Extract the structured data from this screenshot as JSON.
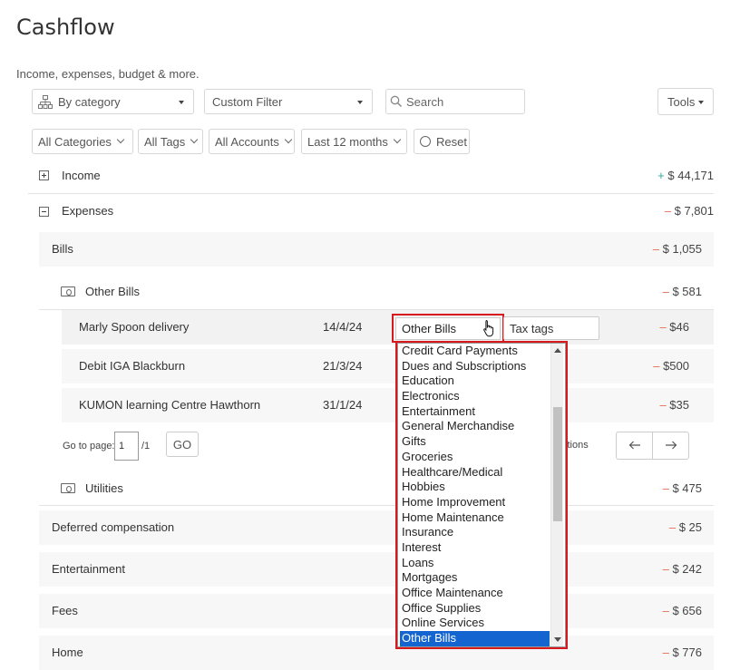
{
  "header": {
    "title": "Cashflow",
    "subtitle": "Income, expenses, budget & more."
  },
  "toolbar": {
    "group_by": "By category",
    "custom_filter": "Custom Filter",
    "search_placeholder": "Search",
    "tools": "Tools"
  },
  "filters": {
    "categories": "All Categories",
    "tags": "All Tags",
    "accounts": "All Accounts",
    "period": "Last 12 months",
    "reset": "Reset"
  },
  "summary": {
    "income": {
      "label": "Income",
      "sign": "+",
      "amount": "$ 44,171"
    },
    "expenses": {
      "label": "Expenses",
      "sign": "–",
      "amount": "$ 7,801"
    }
  },
  "bills": {
    "label": "Bills",
    "sign": "–",
    "amount": "$ 1,055"
  },
  "other_bills": {
    "label": "Other Bills",
    "sign": "–",
    "amount": "$ 581"
  },
  "transactions": [
    {
      "name": "Marly Spoon delivery",
      "date": "14/4/24",
      "sign": "–",
      "amount": "$46"
    },
    {
      "name": "Debit IGA Blackburn",
      "date": "21/3/24",
      "sign": "–",
      "amount": "$500"
    },
    {
      "name": "KUMON learning Centre Hawthorn",
      "date": "31/1/24",
      "sign": "–",
      "amount": "$35"
    }
  ],
  "editor": {
    "category_value": "Other Bills",
    "tags_placeholder": "Tax tags"
  },
  "pagination": {
    "goto_label": "Go to page:",
    "page": "1",
    "total": "/1",
    "go": "GO",
    "transactions_partial": "ctions"
  },
  "utilities": {
    "label": "Utilities",
    "sign": "–",
    "amount": "$ 475"
  },
  "groups": [
    {
      "label": "Deferred compensation",
      "sign": "–",
      "amount": "$ 25"
    },
    {
      "label": "Entertainment",
      "sign": "–",
      "amount": "$ 242"
    },
    {
      "label": "Fees",
      "sign": "–",
      "amount": "$ 656"
    },
    {
      "label": "Home",
      "sign": "–",
      "amount": "$ 776"
    }
  ],
  "dropdown": {
    "options": [
      "Credit Card Payments",
      "Dues and Subscriptions",
      "Education",
      "Electronics",
      "Entertainment",
      "General Merchandise",
      "Gifts",
      "Groceries",
      "Healthcare/Medical",
      "Hobbies",
      "Home Improvement",
      "Home Maintenance",
      "Insurance",
      "Interest",
      "Loans",
      "Mortgages",
      "Office Maintenance",
      "Office Supplies",
      "Online Services",
      "Other Bills"
    ],
    "selected": "Other Bills"
  },
  "colors": {
    "negative": "#e56a4f",
    "positive": "#3aa6a0",
    "selection": "#1565d1",
    "highlight_frame": "#d6191d"
  }
}
